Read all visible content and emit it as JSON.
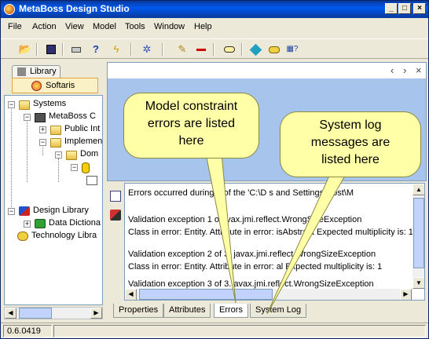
{
  "window": {
    "title": "MetaBoss Design Studio"
  },
  "menu": [
    "File",
    "Action",
    "View",
    "Model",
    "Tools",
    "Window",
    "Help"
  ],
  "toolbar": {
    "icons": [
      "open-icon",
      "save-icon",
      "print-icon",
      "find-icon",
      "lightning-icon",
      "debug-icon",
      "pencil-icon",
      "remove-icon",
      "align-icon",
      "new-element-icon",
      "new-package-icon",
      "new-diagram-icon"
    ]
  },
  "left_panel": {
    "tabs": {
      "library": "Library",
      "softaris": "Softaris"
    },
    "tree": [
      {
        "label": "Systems"
      },
      {
        "label": "MetaBoss C"
      },
      {
        "label": "Public Int"
      },
      {
        "label": "Implemen"
      },
      {
        "label": "Dom"
      },
      {
        "label": "Design Library"
      },
      {
        "label": "Data Dictiona"
      },
      {
        "label": "Technology Libra"
      }
    ]
  },
  "log": {
    "lines": [
      "Errors occurred during         n of the 'C:\\D          s and Settings\\Rost\\M",
      "Validation exception 1 o          avax.jmi.reflect.WrongSizeException",
      "Class in error: Entity. Attribute in error: isAbstract Expected multiplicity is: 1",
      "Validation exception 2 of 3.   javax.jmi.reflect.WrongSizeException",
      "Class in error: Entity. Attribute in error:    al Expected multiplicity is: 1",
      "Validation exception 3 of 3.   avax.jmi.reflect.WrongSizeException"
    ]
  },
  "bottom_tabs": [
    "Properties",
    "Attributes",
    "Errors",
    "System Log"
  ],
  "active_bottom_tab": "Errors",
  "status": {
    "version": "0.6.0419"
  },
  "callouts": {
    "errors": [
      "Model constraint",
      "errors are listed",
      "here"
    ],
    "system_log": [
      "System log",
      "messages are",
      "listed here"
    ]
  },
  "colors": {
    "title_bar": "#0058ee",
    "callout_fill": "#ffffa8",
    "diagram_bg": "#a6c4ec"
  }
}
